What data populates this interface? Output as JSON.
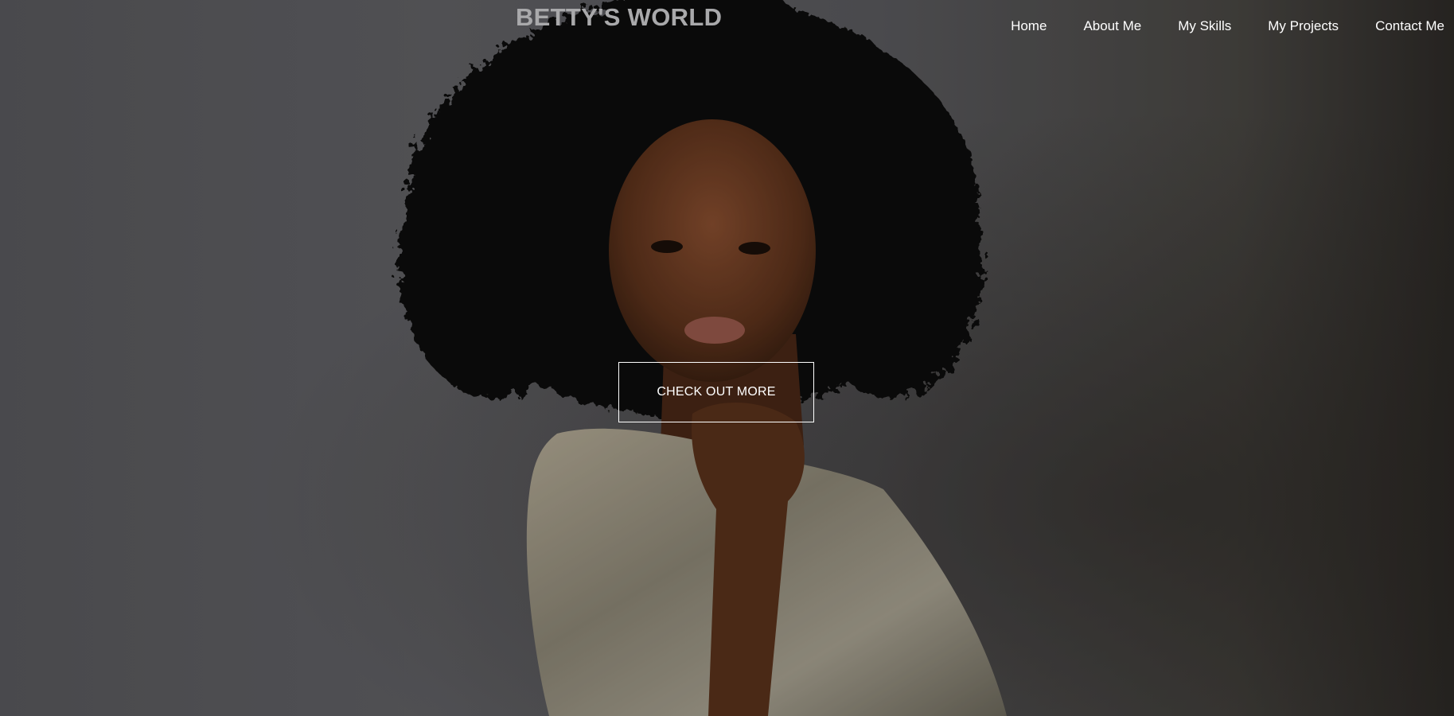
{
  "site": {
    "brand": "BETTY'S WORLD"
  },
  "nav": {
    "items": [
      {
        "label": "Home"
      },
      {
        "label": "About Me"
      },
      {
        "label": "My Skills"
      },
      {
        "label": "My Projects"
      },
      {
        "label": "Contact Me"
      }
    ]
  },
  "hero": {
    "cta_label": "CHECK OUT MORE",
    "image_subject": "portrait-photo"
  },
  "colors": {
    "brand_text": "#a9a9ab",
    "nav_text": "#ffffff",
    "background": "#5b5b5f",
    "cta_border": "#ffffff"
  }
}
